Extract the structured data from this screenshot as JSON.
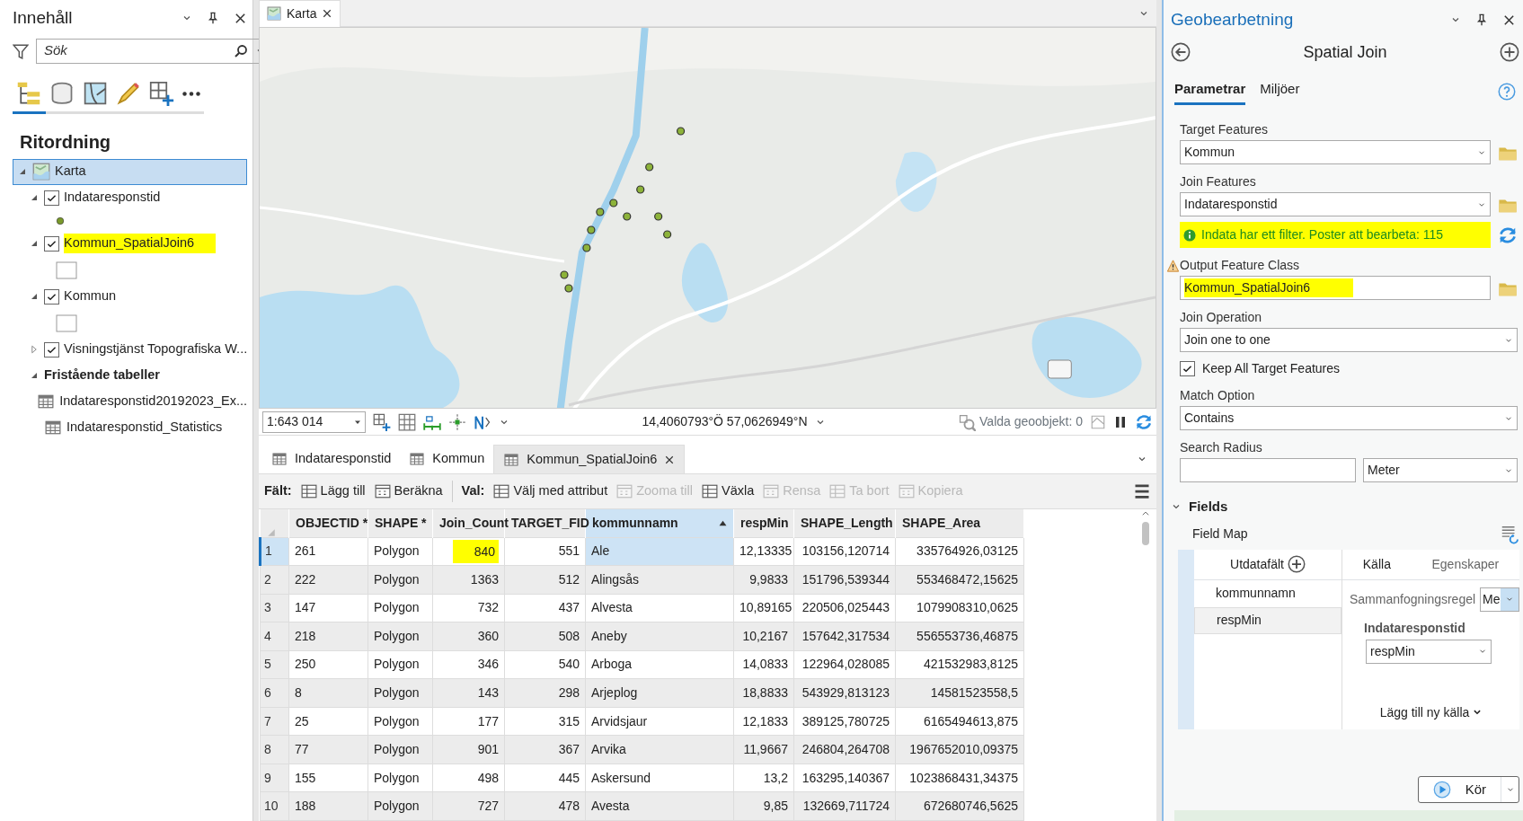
{
  "contents_pane": {
    "title": "Innehåll",
    "search": {
      "placeholder": "Sök"
    },
    "view_tabs": [
      {
        "kind": "drawing-order",
        "selected": true
      },
      {
        "kind": "data-source",
        "selected": false
      },
      {
        "kind": "map-view",
        "selected": false
      },
      {
        "kind": "editing",
        "selected": false
      },
      {
        "kind": "snapping",
        "selected": false
      },
      {
        "kind": "more",
        "selected": false
      }
    ],
    "heading": "Ritordning",
    "tree": [
      {
        "kind": "map",
        "label": "Karta",
        "selected": true,
        "expanded": true,
        "children": [
          {
            "kind": "layer",
            "label": "Indataresponstid",
            "selected": false,
            "checked": true,
            "expanded": true,
            "symbol": {
              "kind": "point"
            },
            "highlighted": false
          },
          {
            "kind": "layer",
            "label": "Kommun_SpatialJoin6",
            "selected": false,
            "checked": true,
            "expanded": true,
            "symbol": {
              "kind": "polygon"
            },
            "highlighted": true
          },
          {
            "kind": "layer",
            "label": "Kommun",
            "selected": false,
            "checked": true,
            "expanded": true,
            "symbol": {
              "kind": "polygon"
            },
            "highlighted": false
          },
          {
            "kind": "layer",
            "label": "Visningstjänst Topografiska W...",
            "selected": false,
            "checked": true,
            "expanded": false,
            "highlighted": false
          }
        ]
      },
      {
        "kind": "group",
        "label": "Fristående tabeller",
        "selected": false,
        "expanded": true,
        "children": [
          {
            "kind": "table",
            "label": "Indataresponstid20192023_Ex...",
            "selected": false
          },
          {
            "kind": "table",
            "label": "Indataresponstid_Statistics",
            "selected": false
          }
        ]
      }
    ]
  },
  "map_view": {
    "tab": {
      "label": "Karta"
    },
    "scale": "1:643 014",
    "coordinates": "14,4060793°Ö 57,0626949°N",
    "selection": "Valda geoobjekt: 0"
  },
  "table_view": {
    "tabs": [
      {
        "label": "Indataresponstid",
        "selected": false
      },
      {
        "label": "Kommun",
        "selected": false
      },
      {
        "label": "Kommun_SpatialJoin6",
        "selected": true
      }
    ],
    "toolbar": [
      {
        "kind": "label",
        "text": "Fält:"
      },
      {
        "kind": "button",
        "text": "Lägg till",
        "disabled": false
      },
      {
        "kind": "button",
        "text": "Beräkna",
        "disabled": false
      },
      {
        "kind": "separator"
      },
      {
        "kind": "label",
        "text": "Val:"
      },
      {
        "kind": "button",
        "text": "Välj med attribut",
        "disabled": false
      },
      {
        "kind": "button",
        "text": "Zooma till",
        "disabled": true
      },
      {
        "kind": "button",
        "text": "Växla",
        "disabled": false
      },
      {
        "kind": "button",
        "text": "Rensa",
        "disabled": true
      },
      {
        "kind": "button",
        "text": "Ta bort",
        "disabled": true
      },
      {
        "kind": "button",
        "text": "Kopiera",
        "disabled": true
      }
    ],
    "table": {
      "columns": [
        {
          "name": "OBJECTID *",
          "numeric": false,
          "sorted": false
        },
        {
          "name": "SHAPE *",
          "numeric": false,
          "sorted": false
        },
        {
          "name": "Join_Count",
          "numeric": true,
          "sorted": false
        },
        {
          "name": "TARGET_FID",
          "numeric": true,
          "sorted": false
        },
        {
          "name": "kommunnamn",
          "numeric": false,
          "sorted": true
        },
        {
          "name": "respMin",
          "numeric": true,
          "sorted": false
        },
        {
          "name": "SHAPE_Length",
          "numeric": true,
          "sorted": false
        },
        {
          "name": "SHAPE_Area",
          "numeric": true,
          "sorted": false
        }
      ],
      "rows": [
        {
          "number": "1",
          "selected": true,
          "cells": [
            "261",
            "Polygon",
            {
              "text": "840",
              "highlighted": true
            },
            "551",
            "Ale",
            "12,13335",
            "103156,120714",
            "335764926,03125"
          ]
        },
        {
          "number": "2",
          "selected": false,
          "cells": [
            "222",
            "Polygon",
            "1363",
            "512",
            "Alingsås",
            "9,9833",
            "151796,539344",
            "553468472,15625"
          ]
        },
        {
          "number": "3",
          "selected": false,
          "cells": [
            "147",
            "Polygon",
            "732",
            "437",
            "Alvesta",
            "10,89165",
            "220506,025443",
            "1079908310,0625"
          ]
        },
        {
          "number": "4",
          "selected": false,
          "cells": [
            "218",
            "Polygon",
            "360",
            "508",
            "Aneby",
            "10,2167",
            "157642,317534",
            "556553736,46875"
          ]
        },
        {
          "number": "5",
          "selected": false,
          "cells": [
            "250",
            "Polygon",
            "346",
            "540",
            "Arboga",
            "14,0833",
            "122964,028085",
            "421532983,8125"
          ]
        },
        {
          "number": "6",
          "selected": false,
          "cells": [
            "8",
            "Polygon",
            "143",
            "298",
            "Arjeplog",
            "18,8833",
            "543929,813123",
            "14581523558,5"
          ]
        },
        {
          "number": "7",
          "selected": false,
          "cells": [
            "25",
            "Polygon",
            "177",
            "315",
            "Arvidsjaur",
            "12,1833",
            "389125,780725",
            "6165494613,875"
          ]
        },
        {
          "number": "8",
          "selected": false,
          "cells": [
            "77",
            "Polygon",
            "901",
            "367",
            "Arvika",
            "11,9667",
            "246804,264708",
            "1967652010,09375"
          ]
        },
        {
          "number": "9",
          "selected": false,
          "cells": [
            "155",
            "Polygon",
            "498",
            "445",
            "Askersund",
            "13,2",
            "163295,140367",
            "1023868431,34375"
          ]
        },
        {
          "number": "10",
          "selected": false,
          "cells": [
            "188",
            "Polygon",
            "727",
            "478",
            "Avesta",
            "9,85",
            "132669,711724",
            "672680746,5625"
          ]
        }
      ]
    }
  },
  "geoprocessing": {
    "title": "Geobearbetning",
    "tool": "Spatial Join",
    "tabs": [
      {
        "label": "Parametrar",
        "selected": true
      },
      {
        "label": "Miljöer",
        "selected": false
      }
    ],
    "parameters": [
      {
        "kind": "select",
        "label": "Target Features",
        "value": "Kommun",
        "browse": true,
        "warning": false,
        "highlighted": false
      },
      {
        "kind": "select",
        "label": "Join Features",
        "value": "Indataresponstid",
        "browse": true,
        "warning": false,
        "highlighted": false,
        "message": {
          "text": "Indata har ett filter. Poster att bearbeta: 115",
          "highlighted": true
        }
      },
      {
        "kind": "text",
        "label": "Output Feature Class",
        "value": "Kommun_SpatialJoin6",
        "browse": true,
        "warning": true,
        "highlighted": true
      },
      {
        "kind": "select",
        "label": "Join Operation",
        "value": "Join one to one",
        "browse": false,
        "warning": false,
        "highlighted": false
      },
      {
        "kind": "checkbox",
        "label": "Keep All Target Features",
        "checked": true
      },
      {
        "kind": "select",
        "label": "Match Option",
        "value": "Contains",
        "browse": false,
        "warning": false,
        "highlighted": false
      },
      {
        "kind": "distance",
        "label": "Search Radius",
        "unit": "Meter"
      }
    ],
    "fields": {
      "title": "Fields",
      "expanded": true,
      "field_map": "Field Map",
      "output_header": "Utdatafält",
      "output_fields": [
        {
          "label": "kommunnamn",
          "selected": false
        },
        {
          "label": "respMin",
          "selected": true
        }
      ],
      "tabs": [
        {
          "label": "Källa",
          "selected": true
        },
        {
          "label": "Egenskaper",
          "selected": false
        }
      ],
      "merge_rule": {
        "label": "Sammanfogningsregel",
        "value": "Me"
      },
      "source": {
        "label": "Indataresponstid",
        "value": "respMin"
      },
      "add_source": "Lägg till ny källa"
    },
    "run_button": "Kör"
  }
}
